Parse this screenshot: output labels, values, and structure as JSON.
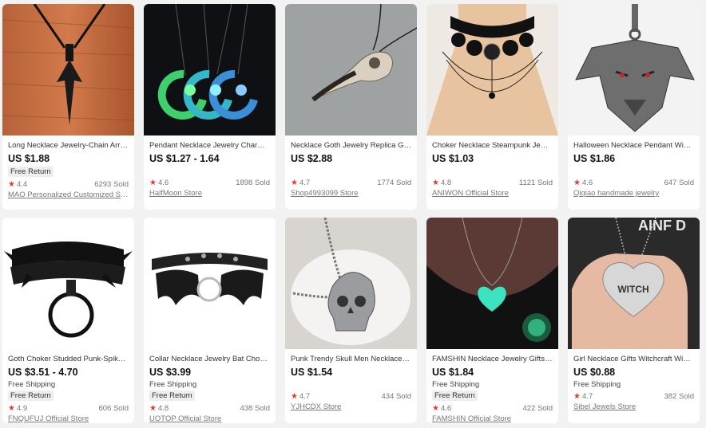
{
  "products": [
    {
      "title": "Long Necklace Jewelry-Chain Arro...",
      "price": "US $1.88",
      "shipping": "",
      "free_return": "Free Return",
      "rating": "4.4",
      "sold": "6293 Sold",
      "store": "MAO Personalized Customized Sto..."
    },
    {
      "title": "Pendant Necklace Jewelry Charm ...",
      "price": "US $1.27 - 1.64",
      "shipping": "",
      "free_return": "",
      "rating": "4.6",
      "sold": "1898 Sold",
      "store": "HalfMoon Store"
    },
    {
      "title": "Necklace Goth Jewelry Replica Gift ...",
      "price": "US $2.88",
      "shipping": "",
      "free_return": "",
      "rating": "4.7",
      "sold": "1774 Sold",
      "store": "Shop4993099 Store"
    },
    {
      "title": "Choker Necklace Steampunk Jewel...",
      "price": "US $1.03",
      "shipping": "",
      "free_return": "",
      "rating": "4.8",
      "sold": "1121 Sold",
      "store": "ANIWON Official Store"
    },
    {
      "title": "Halloween Necklace Pendant Wiza...",
      "price": "US $1.86",
      "shipping": "",
      "free_return": "",
      "rating": "4.6",
      "sold": "647 Sold",
      "store": "Qiqiao handmade jewelry"
    },
    {
      "title": "Goth Choker Studded Punk-Spike ...",
      "price": "US $3.51 - 4.70",
      "shipping": "Free Shipping",
      "free_return": "Free Return",
      "rating": "4.9",
      "sold": "606 Sold",
      "store": "FNQUFUJ Official Store"
    },
    {
      "title": "Collar Necklace Jewelry Bat Choker...",
      "price": "US $3.99",
      "shipping": "Free Shipping",
      "free_return": "Free Return",
      "rating": "4.8",
      "sold": "438 Sold",
      "store": "UOTOP Official Store"
    },
    {
      "title": "Punk Trendy Skull Men Necklace S...",
      "price": "US $1.54",
      "shipping": "",
      "free_return": "",
      "rating": "4.7",
      "sold": "434 Sold",
      "store": "YJHCDX Store"
    },
    {
      "title": "FAMSHIN Necklace Jewelry Gifts H...",
      "price": "US $1.84",
      "shipping": "Free Shipping",
      "free_return": "Free Return",
      "rating": "4.6",
      "sold": "422 Sold",
      "store": "FAMSHIN Official Store"
    },
    {
      "title": "Girl Necklace Gifts Witchcraft Wicc...",
      "price": "US $0.88",
      "shipping": "Free Shipping",
      "free_return": "",
      "rating": "4.7",
      "sold": "382 Sold",
      "store": "Sibel Jewels Store"
    }
  ],
  "images": {
    "witch_heart_text": "WITCH",
    "bg_text_partial": "AINF D"
  },
  "icons": {
    "rating": "star-icon"
  },
  "colors": {
    "star": "#e43a2f",
    "page_bg": "#f2f2f2",
    "card_bg": "#ffffff"
  }
}
